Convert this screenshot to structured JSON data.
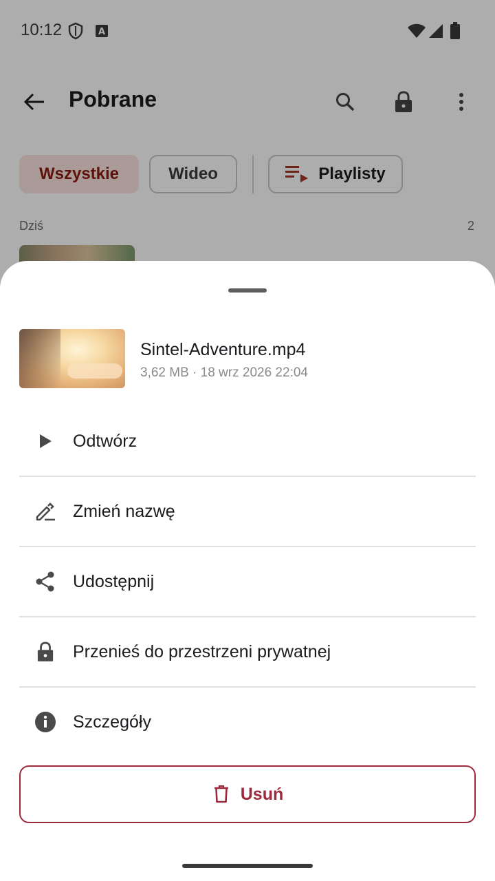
{
  "status_bar": {
    "time": "10:12",
    "icons": [
      "shield-icon",
      "text-a-icon",
      "wifi-icon",
      "signal-icon",
      "battery-icon"
    ]
  },
  "top_bar": {
    "title": "Pobrane",
    "actions": [
      "back-arrow-icon",
      "search-icon",
      "lock-icon",
      "more-vert-icon"
    ]
  },
  "filters": {
    "all": "Wszystkie",
    "video": "Wideo",
    "playlists": "Playlisty",
    "selected": "Wszystkie"
  },
  "list": {
    "section_label": "Dziś",
    "section_count": "2"
  },
  "sheet": {
    "file": {
      "name": "Sintel-Adventure.mp4",
      "meta": "3,62 MB · 18 wrz 2026 22:04"
    },
    "menu": [
      {
        "label": "Odtwórz",
        "icon": "play-icon"
      },
      {
        "label": "Zmień nazwę",
        "icon": "edit-icon"
      },
      {
        "label": "Udostępnij",
        "icon": "share-icon"
      },
      {
        "label": "Przenieś do przestrzeni prywatnej",
        "icon": "lock-icon"
      },
      {
        "label": "Szczegóły",
        "icon": "info-icon"
      }
    ],
    "delete_label": "Usuń"
  },
  "colors": {
    "accent": "#9c2a3c",
    "chip_selected_bg": "#fbe4e0",
    "chip_selected_text": "#8a1c12",
    "scrim": "rgba(0,0,0,0.32)"
  }
}
